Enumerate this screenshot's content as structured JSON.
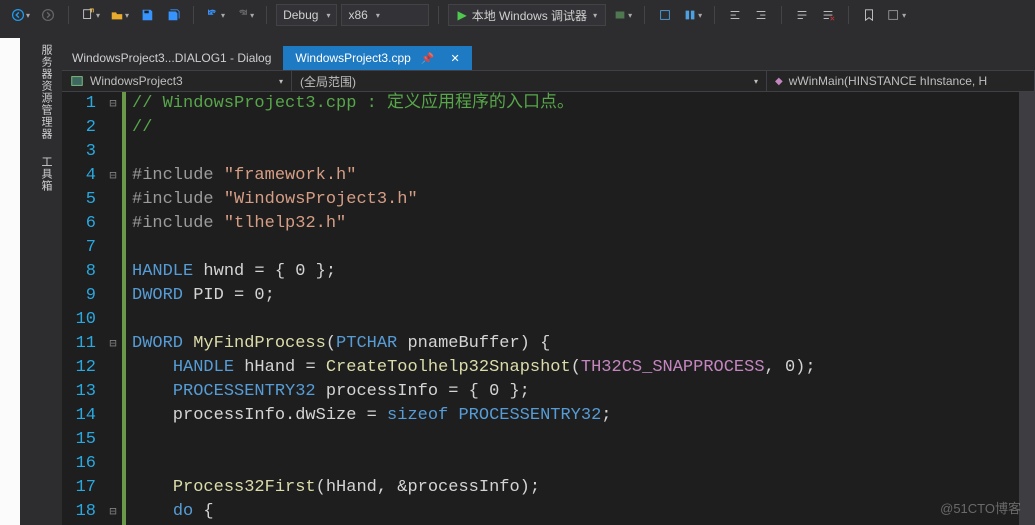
{
  "toolbar": {
    "config_label": "Debug",
    "platform_label": "x86",
    "run_label": "本地 Windows 调试器"
  },
  "tabs": {
    "inactive": "WindowsProject3...DIALOG1 - Dialog",
    "active": "WindowsProject3.cpp"
  },
  "navbar": {
    "project": "WindowsProject3",
    "scope": "(全局范围)",
    "func": "wWinMain(HINSTANCE hInstance, H"
  },
  "side": {
    "a": "服务器资源管理器",
    "b": "工具箱"
  },
  "code": {
    "first_line": 1,
    "lines": [
      {
        "kind": "comment",
        "text": "// WindowsProject3.cpp : 定义应用程序的入口点。",
        "fold": "⊟"
      },
      {
        "kind": "comment",
        "text": "//"
      },
      {
        "kind": "blank"
      },
      {
        "kind": "include",
        "file": "framework.h",
        "fold": "⊟"
      },
      {
        "kind": "include",
        "file": "WindowsProject3.h"
      },
      {
        "kind": "include",
        "file": "tlhelp32.h"
      },
      {
        "kind": "blank"
      },
      {
        "kind": "decl",
        "type": "HANDLE",
        "name": "hwnd",
        "init": "{ 0 }"
      },
      {
        "kind": "decl",
        "type": "DWORD",
        "name": "PID",
        "init": "0"
      },
      {
        "kind": "blank"
      },
      {
        "kind": "func_sig",
        "ret": "DWORD",
        "name": "MyFindProcess",
        "params": "PTCHAR pnameBuffer",
        "fold": "⊟"
      },
      {
        "kind": "call_assign",
        "type": "HANDLE",
        "name": "hHand",
        "fn": "CreateToolhelp32Snapshot",
        "args_mac": "TH32CS_SNAPPROCESS",
        "args_tail": ", 0"
      },
      {
        "kind": "decl",
        "type": "PROCESSENTRY32",
        "name": "processInfo",
        "init": "{ 0 }",
        "indent": 1
      },
      {
        "kind": "member_assign",
        "obj": "processInfo",
        "member": "dwSize",
        "rhs_kw": "sizeof",
        "rhs": "PROCESSENTRY32"
      },
      {
        "kind": "blank"
      },
      {
        "kind": "blank"
      },
      {
        "kind": "call",
        "fn": "Process32First",
        "args": "hHand, &processInfo"
      },
      {
        "kind": "do_open",
        "fold": "⊟"
      }
    ]
  },
  "watermark": "@51CTO博客"
}
